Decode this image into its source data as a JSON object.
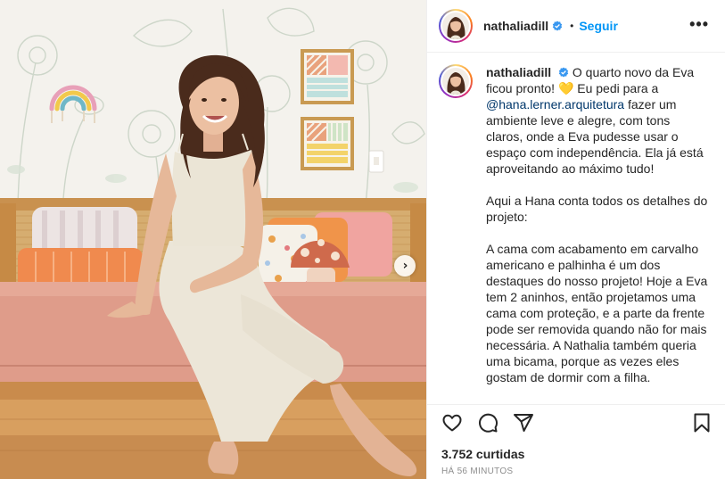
{
  "post": {
    "username": "nathaliadill",
    "follow_label": "Seguir",
    "separator": "•",
    "more_label": "•••",
    "carousel_next": "›",
    "caption": {
      "username": "nathaliadill",
      "paragraph1_before_mention": "O quarto novo da Eva ficou pronto! 💛 Eu pedi para a ",
      "mention": "@hana.lerner.arquitetura",
      "paragraph1_after_mention": " fazer um ambiente leve e alegre, com tons claros, onde a Eva pudesse usar o espaço com independência. Ela já está aproveitando ao máximo tudo!",
      "paragraph2": "Aqui a Hana conta todos os detalhes do projeto:",
      "paragraph3": "A cama com acabamento em carvalho americano e palhinha é um dos destaques do nosso projeto! Hoje a Eva tem 2 aninhos, então projetamos uma cama com proteção, e a parte da frente pode ser removida quando não for mais necessária. A Nathalia também queria uma bicama, porque as vezes eles gostam de dormir com a filha."
    },
    "likes": "3.752 curtidas",
    "time_ago": "HÁ 56 MINUTOS"
  },
  "icons": {
    "verified": "verified-badge-icon",
    "like": "heart-icon",
    "comment": "comment-icon",
    "share": "paper-plane-icon",
    "save": "bookmark-icon"
  },
  "colors": {
    "accent": "#0095f6",
    "verified": "#3897f0",
    "text": "#262626",
    "muted": "#8e8e8e",
    "mention": "#00376b"
  }
}
